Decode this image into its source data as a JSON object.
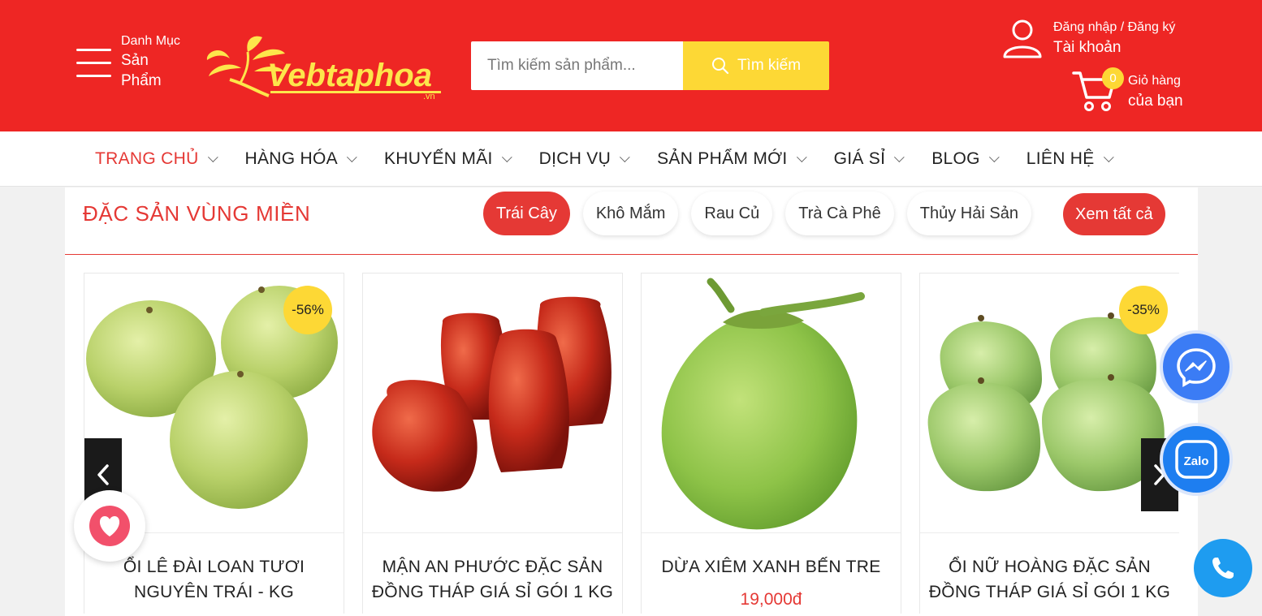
{
  "header": {
    "menu_line1": "Danh Mục",
    "menu_line2": "Sản",
    "menu_line3": "Phẩm",
    "logo_text": "Vebtaphoa",
    "logo_sub": ".vn",
    "search_placeholder": "Tìm kiếm sản phẩm...",
    "search_button": "Tìm kiếm",
    "account_line1": "Đăng nhập / Đăng ký",
    "account_line2": "Tài khoản",
    "cart_count": "0",
    "cart_line1": "Giỏ hàng",
    "cart_line2": "của bạn"
  },
  "nav": {
    "items": [
      {
        "label": "TRANG CHỦ",
        "active": true
      },
      {
        "label": "HÀNG HÓA"
      },
      {
        "label": "KHUYẾN MÃI"
      },
      {
        "label": "DỊCH VỤ"
      },
      {
        "label": "SẢN PHẨM MỚI"
      },
      {
        "label": "GIÁ SỈ"
      },
      {
        "label": "BLOG"
      },
      {
        "label": "LIÊN HỆ"
      }
    ]
  },
  "section": {
    "title": "ĐẶC SẢN VÙNG MIỀN",
    "tabs": [
      "Trái Cây",
      "Khô Mắm",
      "Rau Củ",
      "Trà Cà Phê",
      "Thủy Hải Sản"
    ],
    "view_all": "Xem tất cả"
  },
  "products": [
    {
      "name": "ỔI LÊ ĐÀI LOAN TƯƠI NGUYÊN TRÁI - KG",
      "discount": "-56%",
      "price": ""
    },
    {
      "name": "MẬN AN PHƯỚC ĐẶC SẢN ĐỒNG THÁP GIÁ SỈ GÓI 1 KG",
      "discount": "",
      "price": ""
    },
    {
      "name": "DỪA XIÊM XANH BẾN TRE",
      "discount": "",
      "price": "19,000đ"
    },
    {
      "name": "ỔI NỮ HOÀNG ĐẶC SẢN ĐỒNG THÁP GIÁ SỈ GÓI 1 KG",
      "discount": "-35%",
      "price": ""
    }
  ],
  "colors": {
    "brand_red": "#ee2624",
    "accent_yellow": "#fdd835",
    "messenger_blue": "#3b7cf5",
    "zalo_blue": "#1e7ef0"
  },
  "floating": {
    "zalo_label": "Zalo"
  }
}
